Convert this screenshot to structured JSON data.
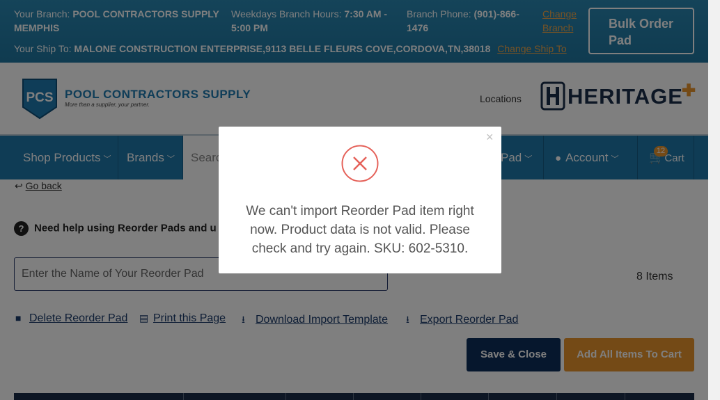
{
  "topbar": {
    "branch_label": "Your Branch:",
    "branch_value": "POOL CONTRACTORS SUPPLY MEMPHIS",
    "hours_label": "Weekdays Branch Hours:",
    "hours_value": "7:30 AM - 5:00 PM",
    "phone_label": "Branch Phone:",
    "phone_value": "(901)-866-1476",
    "change_branch": "Change Branch",
    "shipto_label": "Your Ship To:",
    "shipto_value": "MALONE CONSTRUCTION ENTERPRISE,9113 BELLE FLEURS COVE,CORDOVA,TN,38018",
    "change_shipto": "Change Ship To",
    "bulk_order": "Bulk Order Pad"
  },
  "header": {
    "logo_badge": "PCS",
    "logo_name": "POOL CONTRACTORS SUPPLY",
    "logo_tagline": "More than a supplier, your partner.",
    "locations": "Locations",
    "heritage": "HERITAGE"
  },
  "nav": {
    "shop_products": "Shop Products",
    "brands": "Brands",
    "search_placeholder": "Searc",
    "reorder_pad": "Pad",
    "account": "Account",
    "cart": "Cart",
    "cart_count": "12"
  },
  "content": {
    "go_back": "Go back",
    "help_text": "Need help using Reorder Pads and u",
    "pad_name_placeholder": "Enter the Name of Your Reorder Pad",
    "items_count": "8 Items",
    "actions": {
      "delete": "Delete Reorder Pad",
      "print": "Print this Page",
      "download": "Download Import Template",
      "export": "Export Reorder Pad"
    },
    "save_close": "Save & Close",
    "add_all": "Add All Items To Cart"
  },
  "modal": {
    "close": "×",
    "message": "We can't import Reorder Pad item right now. Product data is not valid. Please check and try again. SKU: 602-5310."
  },
  "colors": {
    "brand_blue": "#1e79ab",
    "accent_orange": "#e8952c",
    "navy": "#0d2f5a",
    "error_red": "#e5625a"
  }
}
